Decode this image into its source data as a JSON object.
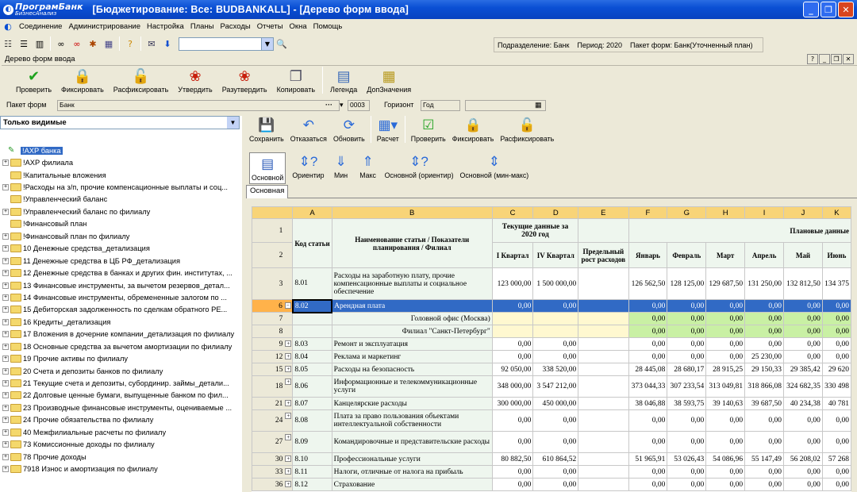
{
  "window": {
    "logo_main": "ПрограмБанк",
    "logo_sub": "БизнесАнализ",
    "title": "[Бюджетирование: Все: BUDBANKALL] - [Дерево форм ввода]"
  },
  "menu": [
    "Соединение",
    "Администрирование",
    "Настройка",
    "Планы",
    "Расходы",
    "Отчеты",
    "Окна",
    "Помощь"
  ],
  "statusinfo": {
    "division": "Подразделение: Банк",
    "period": "Период: 2020",
    "package": "Пакет форм: Банк(Уточненный план)"
  },
  "docwin": {
    "title": "Дерево форм ввода"
  },
  "main_toolbar": [
    {
      "label": "Проверить",
      "icon": "check-icon"
    },
    {
      "label": "Фиксировать",
      "icon": "lock-icon"
    },
    {
      "label": "Расфиксировать",
      "icon": "unlock-icon"
    },
    {
      "label": "Утвердить",
      "icon": "seal-icon"
    },
    {
      "label": "Разутвердить",
      "icon": "unseal-icon"
    },
    {
      "label": "Копировать",
      "icon": "copy-icon"
    },
    {
      "label": "Легенда",
      "icon": "legend-icon"
    },
    {
      "label": "ДопЗначения",
      "icon": "extra-values-icon"
    }
  ],
  "fields": {
    "packet_label": "Пакет форм",
    "packet_value": "Банк",
    "packet_code": "0003",
    "horizon_label": "Горизонт",
    "horizon_value": "Год"
  },
  "filter": {
    "value": "Только видимые"
  },
  "tree": [
    {
      "label": "!АХР банка",
      "pm": "",
      "type": "check",
      "selected": true,
      "root": true
    },
    {
      "label": "!АХР филиала",
      "pm": "+",
      "type": "folder"
    },
    {
      "label": "!Капитальные вложения",
      "pm": "",
      "type": "folder"
    },
    {
      "label": "!Расходы на з/п, прочие компенсационные выплаты и соц...",
      "pm": "+",
      "type": "folder"
    },
    {
      "label": "!Управленческий баланс",
      "pm": "",
      "type": "folder"
    },
    {
      "label": "!Управленческий баланс по филиалу",
      "pm": "+",
      "type": "folder"
    },
    {
      "label": "!Финансовый план",
      "pm": "",
      "type": "folder"
    },
    {
      "label": "!Финансовый план по филиалу",
      "pm": "+",
      "type": "folder"
    },
    {
      "label": "10 Денежные средства_детализация",
      "pm": "+",
      "type": "folder"
    },
    {
      "label": "11 Денежные средства в ЦБ РФ_детализация",
      "pm": "+",
      "type": "folder"
    },
    {
      "label": "12 Денежные средства в банках и других фин. институтах, ...",
      "pm": "+",
      "type": "folder"
    },
    {
      "label": "13 Финансовые инструменты, за вычетом резервов_детал...",
      "pm": "+",
      "type": "folder"
    },
    {
      "label": "14 Финансовые инструменты, обремененные залогом по ...",
      "pm": "+",
      "type": "folder"
    },
    {
      "label": "15 Дебиторская задолженность по сделкам обратного РЕ...",
      "pm": "+",
      "type": "folder"
    },
    {
      "label": "16 Кредиты_детализация",
      "pm": "+",
      "type": "folder"
    },
    {
      "label": "17 Вложения в дочерние компании_детализация по филиалу",
      "pm": "+",
      "type": "folder"
    },
    {
      "label": "18 Основные средства за вычетом амортизации по филиалу",
      "pm": "+",
      "type": "folder"
    },
    {
      "label": "19 Прочие активы по филиалу",
      "pm": "+",
      "type": "folder"
    },
    {
      "label": "20 Счета и депозиты банков по филиалу",
      "pm": "+",
      "type": "folder"
    },
    {
      "label": "21 Текущие счета и депозиты, субординир. займы_детали...",
      "pm": "+",
      "type": "folder"
    },
    {
      "label": "22 Долговые ценные бумаги, выпущенные банком по фил...",
      "pm": "+",
      "type": "folder"
    },
    {
      "label": "23 Производные финансовые инструменты, оцениваемые ...",
      "pm": "+",
      "type": "folder"
    },
    {
      "label": "24 Прочие обязательства по филиалу",
      "pm": "+",
      "type": "folder"
    },
    {
      "label": "40 Межфилиальные расчеты по филиалу",
      "pm": "+",
      "type": "folder"
    },
    {
      "label": "73 Комиссионные доходы по филиалу",
      "pm": "+",
      "type": "folder"
    },
    {
      "label": "78 Прочие доходы",
      "pm": "+",
      "type": "folder"
    },
    {
      "label": "7918 Износ и амортизация по филиалу",
      "pm": "+",
      "type": "folder"
    }
  ],
  "right_toolbar": [
    {
      "label": "Сохранить",
      "icon": "save-icon"
    },
    {
      "label": "Отказаться",
      "icon": "undo-icon"
    },
    {
      "label": "Обновить",
      "icon": "refresh-icon"
    },
    {
      "label": "Расчет",
      "icon": "calculator-icon"
    },
    {
      "label": "Проверить",
      "icon": "check-icon"
    },
    {
      "label": "Фиксировать",
      "icon": "lock-icon"
    },
    {
      "label": "Расфиксировать",
      "icon": "unlock-icon"
    }
  ],
  "view_toolbar": [
    {
      "label": "Основной",
      "icon": "chart-icon",
      "active": true
    },
    {
      "label": "Ориентир",
      "icon": "arrows-question-icon"
    },
    {
      "label": "Мин",
      "icon": "arrow-down-icon"
    },
    {
      "label": "Макс",
      "icon": "arrow-up-icon"
    },
    {
      "label": "Основной (ориентир)",
      "icon": "arrows-question-icon"
    },
    {
      "label": "Основной (мин-макс)",
      "icon": "arrows-updown-icon"
    }
  ],
  "tab": "Основная",
  "grid": {
    "col_letters": [
      "A",
      "B",
      "C",
      "D",
      "E",
      "F",
      "G",
      "H",
      "I",
      "J",
      "K"
    ],
    "hdr_code": "Код статьи",
    "hdr_name": "Наименование статьи / Показатели планирования / Филиал",
    "hdr_current": "Текущие данные за 2020 год",
    "hdr_q1": "I Квартал",
    "hdr_q4": "IV Квартал",
    "hdr_limit": "Предельный рост расходов",
    "hdr_plan": "Плановые данные",
    "months": [
      "Январь",
      "Февраль",
      "Март",
      "Апрель",
      "Май",
      "Июнь"
    ],
    "rows": [
      {
        "rn": "3",
        "pm": "",
        "code": "8.01",
        "name": "Расходы на заработную плату, прочие компенсационные выплаты и социальное обеспечение",
        "c": "123 000,00",
        "d": "1 500 000,00",
        "e": "",
        "m": [
          "126 562,50",
          "128 125,00",
          "129 687,50",
          "131 250,00",
          "132 812,50",
          "134 375"
        ],
        "h": 3
      },
      {
        "rn": "6",
        "pm": "-",
        "code": "8.02",
        "name": "Арендная плата",
        "c": "0,00",
        "d": "0,00",
        "e": "",
        "m": [
          "0,00",
          "0,00",
          "0,00",
          "0,00",
          "0,00",
          "0,00"
        ],
        "sel": true
      },
      {
        "rn": "7",
        "pm": "",
        "code": "",
        "name": "Головной офис (Москва)",
        "c": "",
        "d": "",
        "e": "",
        "m": [
          "0,00",
          "0,00",
          "0,00",
          "0,00",
          "0,00",
          "0,00"
        ],
        "sub": true
      },
      {
        "rn": "8",
        "pm": "",
        "code": "",
        "name": "Филиал \"Санкт-Петербург\"",
        "c": "",
        "d": "",
        "e": "",
        "m": [
          "0,00",
          "0,00",
          "0,00",
          "0,00",
          "0,00",
          "0,00"
        ],
        "sub": true
      },
      {
        "rn": "9",
        "pm": "+",
        "code": "8.03",
        "name": "Ремонт и эксплуатация",
        "c": "0,00",
        "d": "0,00",
        "e": "",
        "m": [
          "0,00",
          "0,00",
          "0,00",
          "0,00",
          "0,00",
          "0,00"
        ]
      },
      {
        "rn": "12",
        "pm": "+",
        "code": "8.04",
        "name": "Реклама и маркетинг",
        "c": "0,00",
        "d": "0,00",
        "e": "",
        "m": [
          "0,00",
          "0,00",
          "0,00",
          "25 230,00",
          "0,00",
          "0,00"
        ]
      },
      {
        "rn": "15",
        "pm": "+",
        "code": "8.05",
        "name": "Расходы на безопасность",
        "c": "92 050,00",
        "d": "338 520,00",
        "e": "",
        "m": [
          "28 445,08",
          "28 680,17",
          "28 915,25",
          "29 150,33",
          "29 385,42",
          "29 620"
        ]
      },
      {
        "rn": "18",
        "pm": "+",
        "code": "8.06",
        "name": "Информационные и телекоммуникационные услуги",
        "c": "348 000,00",
        "d": "3 547 212,00",
        "e": "",
        "m": [
          "373 044,33",
          "307 233,54",
          "313 049,81",
          "318 866,08",
          "324 682,35",
          "330 498"
        ],
        "h": 2
      },
      {
        "rn": "21",
        "pm": "+",
        "code": "8.07",
        "name": "Канцелярские расходы",
        "c": "300 000,00",
        "d": "450 000,00",
        "e": "",
        "m": [
          "38 046,88",
          "38 593,75",
          "39 140,63",
          "39 687,50",
          "40 234,38",
          "40 781"
        ]
      },
      {
        "rn": "24",
        "pm": "+",
        "code": "8.08",
        "name": "Плата за право пользования объектами интеллектуальной собственности",
        "c": "0,00",
        "d": "0,00",
        "e": "",
        "m": [
          "0,00",
          "0,00",
          "0,00",
          "0,00",
          "0,00",
          "0,00"
        ],
        "h": 2
      },
      {
        "rn": "27",
        "pm": "+",
        "code": "8.09",
        "name": "Командировочные и представительские расходы",
        "c": "0,00",
        "d": "0,00",
        "e": "",
        "m": [
          "0,00",
          "0,00",
          "0,00",
          "0,00",
          "0,00",
          "0,00"
        ],
        "h": 2
      },
      {
        "rn": "30",
        "pm": "+",
        "code": "8.10",
        "name": "Профессиональные услуги",
        "c": "80 882,50",
        "d": "610 864,52",
        "e": "",
        "m": [
          "51 965,91",
          "53 026,43",
          "54 086,96",
          "55 147,49",
          "56 208,02",
          "57 268"
        ]
      },
      {
        "rn": "33",
        "pm": "+",
        "code": "8.11",
        "name": "Налоги, отличные от налога на прибыль",
        "c": "0,00",
        "d": "0,00",
        "e": "",
        "m": [
          "0,00",
          "0,00",
          "0,00",
          "0,00",
          "0,00",
          "0,00"
        ]
      },
      {
        "rn": "36",
        "pm": "+",
        "code": "8.12",
        "name": "Страхование",
        "c": "0,00",
        "d": "0,00",
        "e": "",
        "m": [
          "0,00",
          "0,00",
          "0,00",
          "0,00",
          "0,00",
          "0,00"
        ]
      }
    ]
  }
}
